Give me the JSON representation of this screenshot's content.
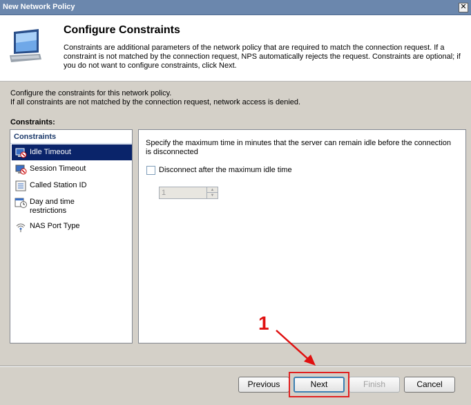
{
  "window": {
    "title": "New Network Policy"
  },
  "header": {
    "title": "Configure Constraints",
    "description": "Constraints are additional parameters of the network policy that are required to match the connection request. If a constraint is not matched by the connection request, NPS automatically rejects the request. Constraints are optional; if you do not want to configure constraints, click Next.",
    "icon": "monitor-icon"
  },
  "intro": {
    "line1": "Configure the constraints for this network policy.",
    "line2": "If all constraints are not matched by the connection request, network access is denied."
  },
  "constraints_label": "Constraints:",
  "constraints": {
    "header": "Constraints",
    "items": [
      {
        "label": "Idle Timeout",
        "icon": "idle-timeout-icon",
        "selected": true
      },
      {
        "label": "Session Timeout",
        "icon": "session-timeout-icon",
        "selected": false
      },
      {
        "label": "Called Station ID",
        "icon": "called-station-icon",
        "selected": false
      },
      {
        "label": "Day and time restrictions",
        "line1": "Day and time",
        "line2": "restrictions",
        "icon": "calendar-icon",
        "selected": false
      },
      {
        "label": "NAS Port Type",
        "icon": "nas-port-icon",
        "selected": false
      }
    ]
  },
  "detail": {
    "spec_line1": "Specify the maximum time in minutes that the server can remain idle before the connection",
    "spec_line2": "is disconnected",
    "checkbox_label": "Disconnect after the maximum idle time",
    "checkbox_checked": false,
    "spinner_value": "1",
    "spinner_enabled": false
  },
  "buttons": {
    "previous": "Previous",
    "next": "Next",
    "finish": "Finish",
    "cancel": "Cancel"
  },
  "annotation": {
    "number": "1",
    "color": "#e01010"
  },
  "colors": {
    "titlebar": "#6b87ad",
    "selection": "#0a246a",
    "panel_bg": "#d4d0c8"
  }
}
